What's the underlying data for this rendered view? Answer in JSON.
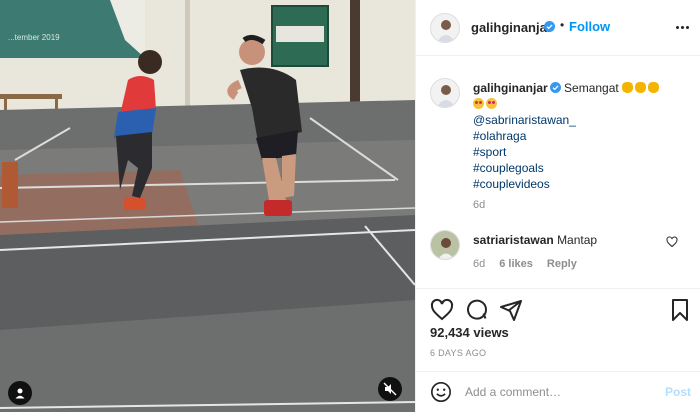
{
  "post": {
    "username": "galihginanjar",
    "follow_label": "Follow",
    "separator": "•",
    "caption": {
      "username": "galihginanjar",
      "text": "Semangat",
      "mention": "@sabrinaristawan_",
      "hashtags": [
        "#olahraga",
        "#sport",
        "#couplegoals",
        "#couplevideos"
      ],
      "time": "6d"
    },
    "comments": [
      {
        "username": "satriaristawan",
        "text": "Mantap",
        "time": "6d",
        "likes": "6 likes",
        "reply_label": "Reply"
      }
    ],
    "views": "92,434 views",
    "posted": "6 DAYS AGO",
    "add_comment_placeholder": "Add a comment…",
    "post_label": "Post"
  },
  "video": {
    "banner_text": "...tember 2019"
  },
  "colors": {
    "accent": "#0095f6",
    "link": "#00376b",
    "muted": "#8e8e8e",
    "post_disabled": "#b2dffc",
    "verified": "#3897f0"
  },
  "icons": {
    "user_tag": "user-icon",
    "mute": "speaker-muted-icon",
    "more": "ellipsis-icon",
    "like": "heart-icon",
    "comment": "speech-bubble-icon",
    "share": "paper-plane-icon",
    "save": "bookmark-icon",
    "emoji": "smiley-icon"
  }
}
